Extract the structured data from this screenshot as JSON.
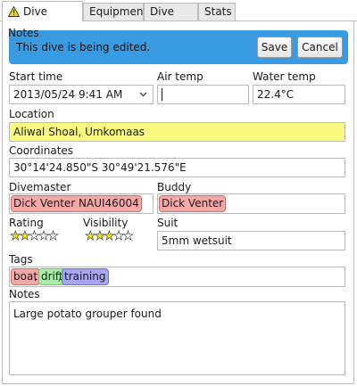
{
  "tabs": [
    {
      "label": "Dive Notes",
      "icon": "warning-icon"
    },
    {
      "label": "Equipment"
    },
    {
      "label": "Dive Info"
    },
    {
      "label": "Stats"
    }
  ],
  "banner": {
    "message": "This dive is being edited.",
    "save_label": "Save",
    "cancel_label": "Cancel",
    "color": "#399be1"
  },
  "form": {
    "start_time": {
      "label": "Start time",
      "value": "2013/05/24 9:41 AM"
    },
    "air_temp": {
      "label": "Air temp",
      "value": ""
    },
    "water_temp": {
      "label": "Water temp",
      "value": "22.4°C"
    },
    "location": {
      "label": "Location",
      "value": "Aliwal Shoal, Umkomaas"
    },
    "coordinates": {
      "label": "Coordinates",
      "value": "30°14'24.850\"S 30°49'21.576\"E"
    },
    "divemaster": {
      "label": "Divemaster",
      "value": "Dick Venter NAUI46004"
    },
    "buddy": {
      "label": "Buddy",
      "value": "Dick Venter"
    },
    "rating": {
      "label": "Rating",
      "value": 2,
      "max": 5
    },
    "visibility": {
      "label": "Visibility",
      "value": 3,
      "max": 5
    },
    "suit": {
      "label": "Suit",
      "value": "5mm wetsuit"
    },
    "tags": {
      "label": "Tags",
      "items": [
        "boat",
        "drift",
        "training"
      ]
    },
    "notes": {
      "label": "Notes",
      "value": "Large potato grouper found"
    }
  }
}
